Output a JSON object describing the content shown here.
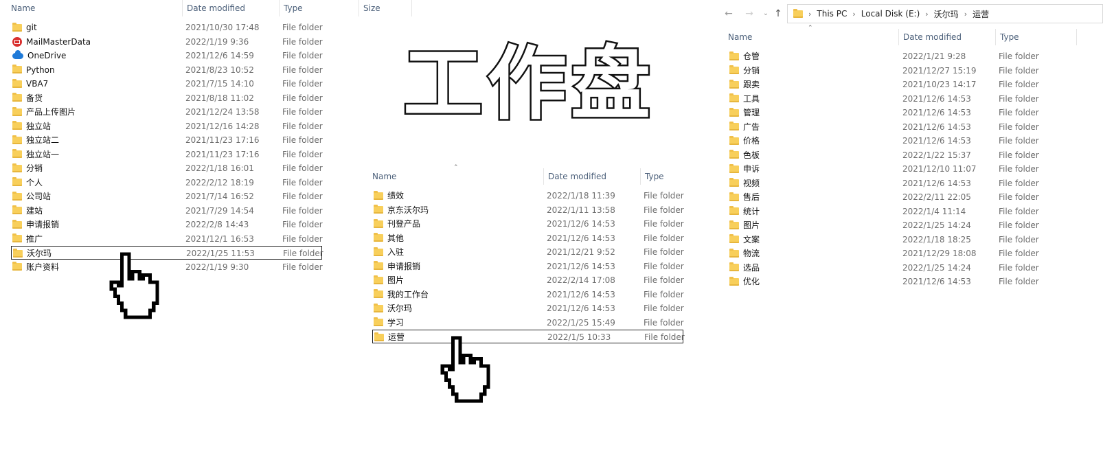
{
  "left_pane": {
    "headers": {
      "name": "Name",
      "date": "Date modified",
      "type": "Type",
      "size": "Size"
    },
    "rows": [
      {
        "icon": "folder-icon",
        "name": "git",
        "date": "2021/10/30 17:48",
        "type": "File folder"
      },
      {
        "icon": "mailmaster-icon",
        "name": "MailMasterData",
        "date": "2022/1/19 9:36",
        "type": "File folder"
      },
      {
        "icon": "onedrive-cloud-icon",
        "name": "OneDrive",
        "date": "2021/12/6 14:59",
        "type": "File folder"
      },
      {
        "icon": "folder-icon",
        "name": "Python",
        "date": "2021/8/23 10:52",
        "type": "File folder"
      },
      {
        "icon": "folder-icon",
        "name": "VBA7",
        "date": "2021/7/15 14:10",
        "type": "File folder"
      },
      {
        "icon": "folder-icon",
        "name": "备货",
        "date": "2021/8/18 11:02",
        "type": "File folder"
      },
      {
        "icon": "folder-icon",
        "name": "产品上传图片",
        "date": "2021/12/24 13:58",
        "type": "File folder"
      },
      {
        "icon": "folder-icon",
        "name": "独立站",
        "date": "2021/12/16 14:28",
        "type": "File folder"
      },
      {
        "icon": "folder-icon",
        "name": "独立站二",
        "date": "2021/11/23 17:16",
        "type": "File folder"
      },
      {
        "icon": "folder-icon",
        "name": "独立站一",
        "date": "2021/11/23 17:16",
        "type": "File folder"
      },
      {
        "icon": "folder-icon",
        "name": "分销",
        "date": "2022/1/18 16:01",
        "type": "File folder"
      },
      {
        "icon": "folder-icon",
        "name": "个人",
        "date": "2022/2/12 18:19",
        "type": "File folder"
      },
      {
        "icon": "folder-icon",
        "name": "公司站",
        "date": "2021/7/14 16:52",
        "type": "File folder"
      },
      {
        "icon": "folder-icon",
        "name": "建站",
        "date": "2021/7/29 14:54",
        "type": "File folder"
      },
      {
        "icon": "folder-icon",
        "name": "申请报销",
        "date": "2022/2/8 14:43",
        "type": "File folder"
      },
      {
        "icon": "folder-icon",
        "name": "推广",
        "date": "2021/12/1 16:53",
        "type": "File folder"
      },
      {
        "icon": "folder-icon",
        "name": "沃尔玛",
        "date": "2022/1/25 11:53",
        "type": "File folder",
        "selected": true
      },
      {
        "icon": "folder-icon",
        "name": "账户资料",
        "date": "2022/1/19 9:30",
        "type": "File folder"
      }
    ]
  },
  "title_text": "工作盘",
  "middle_pane": {
    "headers": {
      "name": "Name",
      "date": "Date modified",
      "type": "Type"
    },
    "rows": [
      {
        "name": "绩效",
        "date": "2022/1/18 11:39",
        "type": "File folder"
      },
      {
        "name": "京东沃尔玛",
        "date": "2022/1/11 13:58",
        "type": "File folder"
      },
      {
        "name": "刊登产品",
        "date": "2021/12/6 14:53",
        "type": "File folder"
      },
      {
        "name": "其他",
        "date": "2021/12/6 14:53",
        "type": "File folder"
      },
      {
        "name": "入驻",
        "date": "2021/12/21 9:52",
        "type": "File folder"
      },
      {
        "name": "申请报销",
        "date": "2021/12/6 14:53",
        "type": "File folder"
      },
      {
        "name": "图片",
        "date": "2022/2/14 17:08",
        "type": "File folder"
      },
      {
        "name": "我的工作台",
        "date": "2021/12/6 14:53",
        "type": "File folder"
      },
      {
        "name": "沃尔玛",
        "date": "2021/12/6 14:53",
        "type": "File folder"
      },
      {
        "name": "学习",
        "date": "2022/1/25 15:49",
        "type": "File folder"
      },
      {
        "name": "运营",
        "date": "2022/1/5 10:33",
        "type": "File folder",
        "selected": true
      }
    ]
  },
  "right_pane": {
    "breadcrumb": [
      "This PC",
      "Local Disk (E:)",
      "沃尔玛",
      "运营"
    ],
    "headers": {
      "name": "Name",
      "date": "Date modified",
      "type": "Type"
    },
    "rows": [
      {
        "name": "仓管",
        "date": "2022/1/21 9:28",
        "type": "File folder"
      },
      {
        "name": "分销",
        "date": "2021/12/27 15:19",
        "type": "File folder"
      },
      {
        "name": "跟卖",
        "date": "2021/10/23 14:17",
        "type": "File folder"
      },
      {
        "name": "工具",
        "date": "2021/12/6 14:53",
        "type": "File folder"
      },
      {
        "name": "管理",
        "date": "2021/12/6 14:53",
        "type": "File folder"
      },
      {
        "name": "广告",
        "date": "2021/12/6 14:53",
        "type": "File folder"
      },
      {
        "name": "价格",
        "date": "2021/12/6 14:53",
        "type": "File folder"
      },
      {
        "name": "色板",
        "date": "2022/1/22 15:37",
        "type": "File folder"
      },
      {
        "name": "申诉",
        "date": "2021/12/10 11:07",
        "type": "File folder"
      },
      {
        "name": "视频",
        "date": "2021/12/6 14:53",
        "type": "File folder"
      },
      {
        "name": "售后",
        "date": "2022/2/11 22:05",
        "type": "File folder"
      },
      {
        "name": "统计",
        "date": "2022/1/4 11:14",
        "type": "File folder"
      },
      {
        "name": "图片",
        "date": "2022/1/25 14:24",
        "type": "File folder"
      },
      {
        "name": "文案",
        "date": "2022/1/18 18:25",
        "type": "File folder"
      },
      {
        "name": "物流",
        "date": "2021/12/29 18:08",
        "type": "File folder"
      },
      {
        "name": "选品",
        "date": "2022/1/25 14:24",
        "type": "File folder"
      },
      {
        "name": "优化",
        "date": "2021/12/6 14:53",
        "type": "File folder"
      }
    ]
  },
  "colors": {
    "folder": "#f8cf5b",
    "header_text": "#4c607a",
    "secondary_text": "#6d6d6d"
  }
}
